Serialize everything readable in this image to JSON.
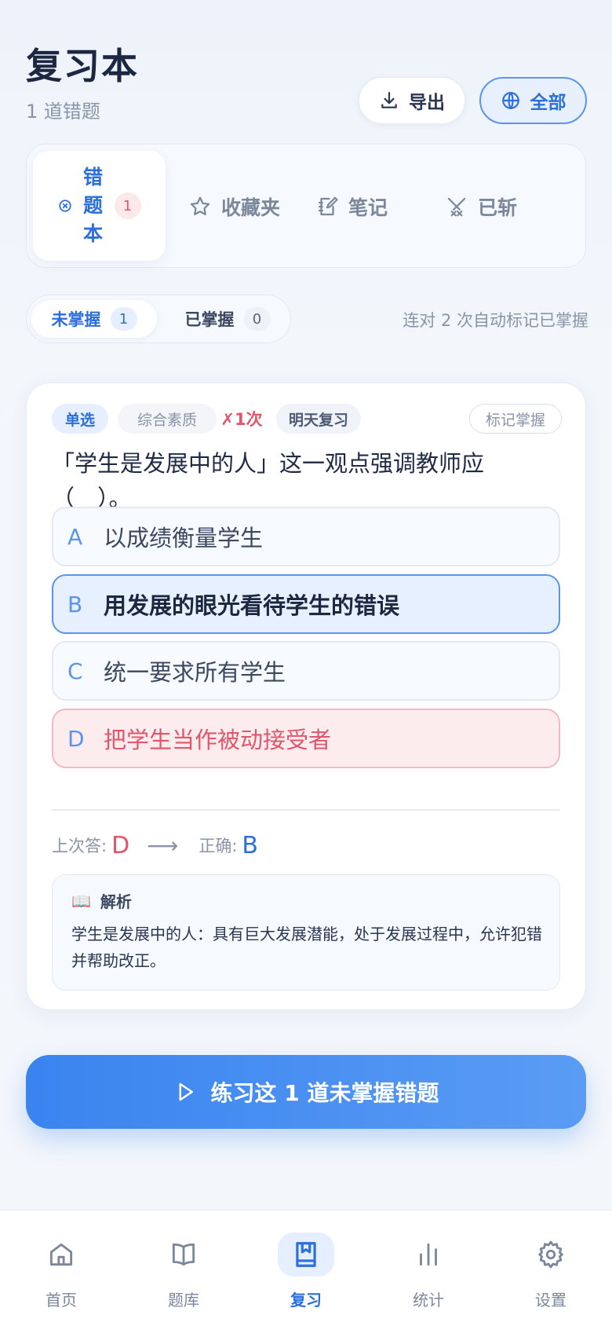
{
  "header": {
    "title": "复习本",
    "subtitle": "1 道错题",
    "export_label": "导出",
    "scope_label": "全部"
  },
  "tabs": [
    {
      "label": "错题本",
      "count": "1",
      "icon": "x-circle-icon"
    },
    {
      "label": "收藏夹",
      "icon": "star-icon"
    },
    {
      "label": "笔记",
      "icon": "notebook-icon"
    },
    {
      "label": "已斩",
      "icon": "crossed-swords-icon"
    }
  ],
  "segment": {
    "unmastered_label": "未掌握",
    "unmastered_count": "1",
    "mastered_label": "已掌握",
    "mastered_count": "0",
    "hint": "连对 2 次自动标记已掌握"
  },
  "question": {
    "type": "单选",
    "subject": "综合素质",
    "wrong_count": "✗1次",
    "review": "明天复习",
    "mark_label": "标记掌握",
    "text": "「学生是发展中的人」这一观点强调教师应（　）。",
    "options": [
      {
        "letter": "A",
        "text": "以成绩衡量学生",
        "state": "normal"
      },
      {
        "letter": "B",
        "text": "用发展的眼光看待学生的错误",
        "state": "correct"
      },
      {
        "letter": "C",
        "text": "统一要求所有学生",
        "state": "normal"
      },
      {
        "letter": "D",
        "text": "把学生当作被动接受者",
        "state": "wrong"
      }
    ],
    "last_answer_label": "上次答:",
    "last_answer": "D",
    "arrow": "⟶",
    "correct_label": "正确:",
    "correct_answer": "B",
    "analysis_title": "解析",
    "analysis_icon": "📖",
    "analysis_text": "学生是发展中的人：具有巨大发展潜能，处于发展过程中，允许犯错并帮助改正。"
  },
  "cta": {
    "label": "练习这 1 道未掌握错题"
  },
  "nav": [
    {
      "label": "首页",
      "icon": "home-icon"
    },
    {
      "label": "题库",
      "icon": "book-open-icon"
    },
    {
      "label": "复习",
      "icon": "bookmark-book-icon",
      "active": true
    },
    {
      "label": "统计",
      "icon": "bar-chart-icon"
    },
    {
      "label": "设置",
      "icon": "gear-icon"
    }
  ],
  "colors": {
    "accent": "#2b6fdc",
    "error": "#e0566a",
    "cta_start": "#3a84f0",
    "cta_end": "#5a9cf4"
  }
}
